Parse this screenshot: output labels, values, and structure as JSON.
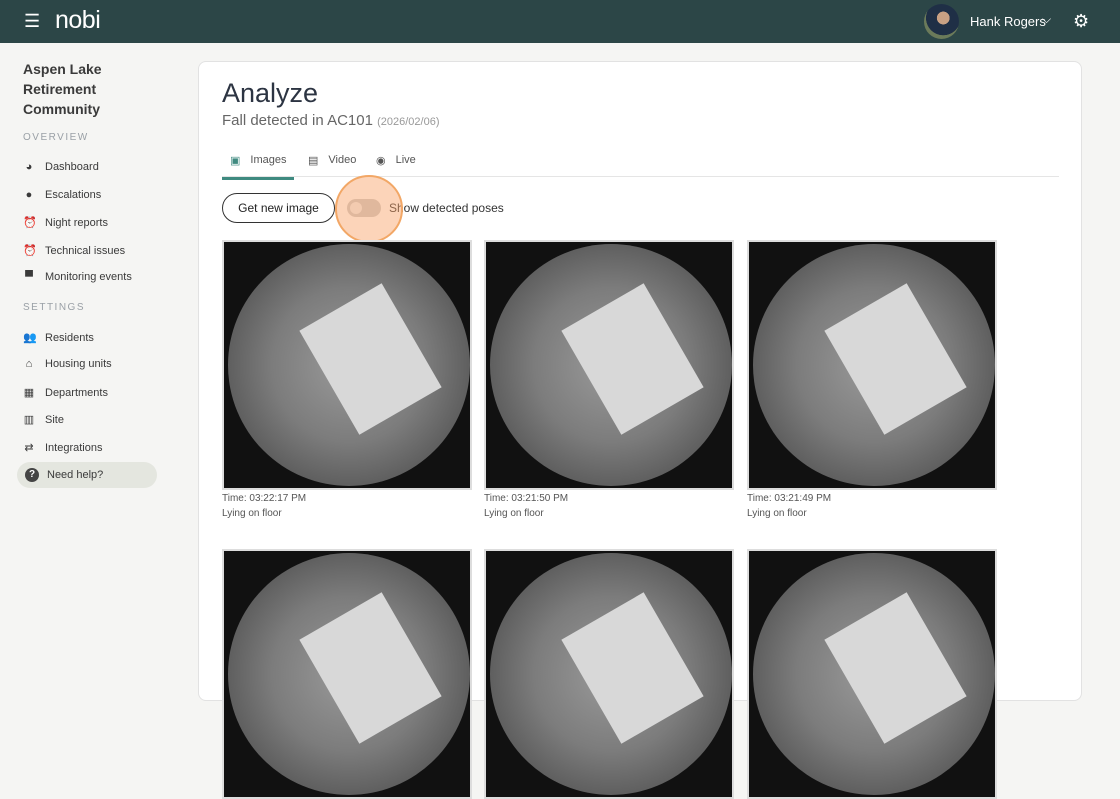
{
  "header": {
    "logo": "nobi",
    "user_name": "Hank Rogers"
  },
  "sidebar": {
    "org": "Aspen Lake Retirement Community",
    "overview_label": "OVERVIEW",
    "settings_label": "SETTINGS",
    "overview": [
      {
        "label": "Dashboard",
        "icon": "gauge-icon"
      },
      {
        "label": "Escalations",
        "icon": "lightbulb-icon"
      },
      {
        "label": "Night reports",
        "icon": "alarm-icon"
      },
      {
        "label": "Technical issues",
        "icon": "alarm-alert-icon"
      },
      {
        "label": "Monitoring events",
        "icon": "siren-icon"
      }
    ],
    "settings": [
      {
        "label": "Residents",
        "icon": "people-icon"
      },
      {
        "label": "Housing units",
        "icon": "house-icon"
      },
      {
        "label": "Departments",
        "icon": "building-icon"
      },
      {
        "label": "Site",
        "icon": "city-icon"
      },
      {
        "label": "Integrations",
        "icon": "swap-icon"
      }
    ],
    "help": "Need help?"
  },
  "main": {
    "title": "Analyze",
    "subtitle": "Fall detected in AC101",
    "date": "(2026/02/06)",
    "tabs": [
      "Images",
      "Video",
      "Live"
    ],
    "get_image": "Get new image",
    "toggle_label": "Show detected poses",
    "toggle_on": false,
    "images": [
      {
        "time": "Time: 03:22:17 PM",
        "status": "Lying on floor"
      },
      {
        "time": "Time: 03:21:50 PM",
        "status": "Lying on floor"
      },
      {
        "time": "Time: 03:21:49 PM",
        "status": "Lying on floor"
      }
    ]
  }
}
